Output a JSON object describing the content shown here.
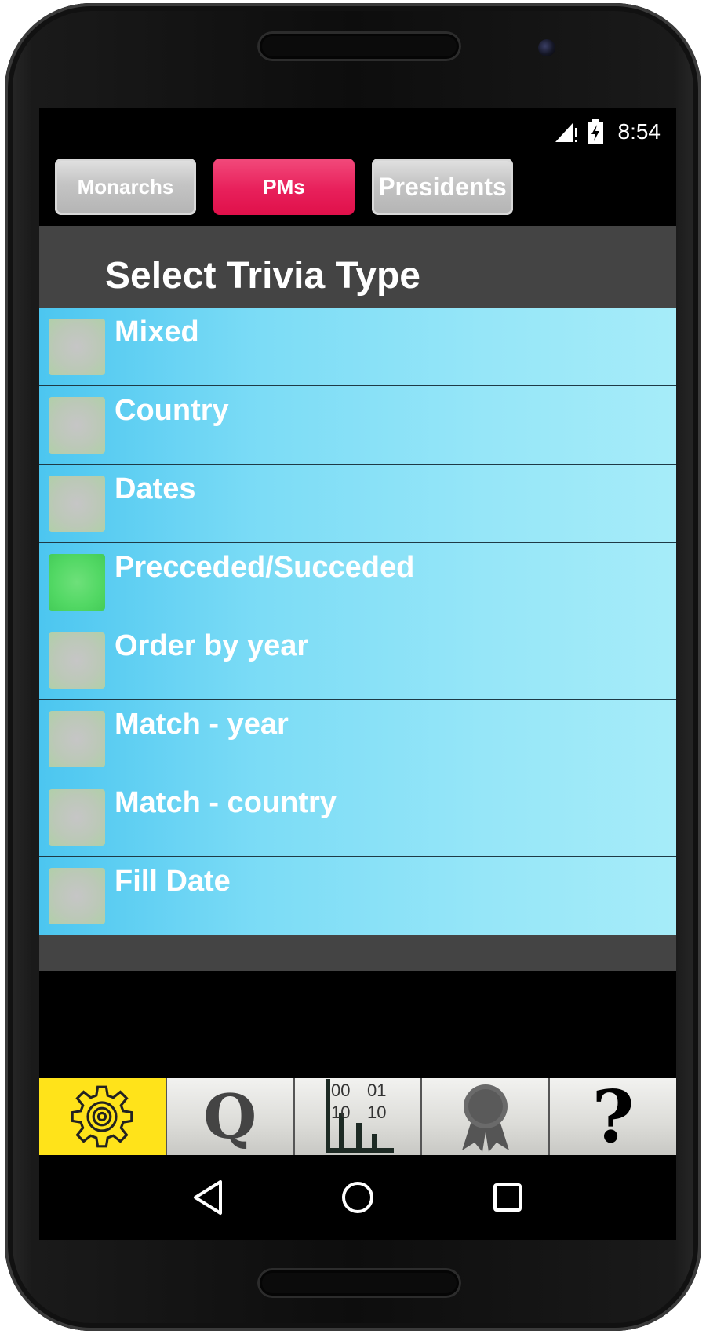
{
  "status_bar": {
    "time": "8:54",
    "icons": [
      "signal-icon",
      "battery-charging-icon"
    ]
  },
  "tabs": [
    {
      "label": "Monarchs",
      "active": false
    },
    {
      "label": "PMs",
      "active": true
    },
    {
      "label": "Presidents",
      "active": false
    }
  ],
  "panel": {
    "title": "Select Trivia Type",
    "items": [
      {
        "label": "Mixed",
        "checked": false
      },
      {
        "label": "Country",
        "checked": false
      },
      {
        "label": "Dates",
        "checked": false
      },
      {
        "label": "Precceded/Succeded",
        "checked": true
      },
      {
        "label": "Order by year",
        "checked": false
      },
      {
        "label": "Match - year",
        "checked": false
      },
      {
        "label": "Match - country",
        "checked": false
      },
      {
        "label": "Fill Date",
        "checked": false
      }
    ]
  },
  "bottom_nav": {
    "items": [
      {
        "icon": "gear-icon",
        "active": true
      },
      {
        "icon": "quiz-q-icon",
        "glyph": "Q",
        "active": false
      },
      {
        "icon": "stats-chart-icon",
        "digits": [
          "00",
          "01",
          "10",
          "10"
        ],
        "active": false
      },
      {
        "icon": "award-ribbon-icon",
        "active": false
      },
      {
        "icon": "help-icon",
        "glyph": "?",
        "active": false
      }
    ]
  },
  "system_nav": {
    "icons": [
      "back-icon",
      "home-icon",
      "recents-icon"
    ]
  },
  "colors": {
    "active_tab": "#e8205b",
    "inactive_tab": "#c4c4c4",
    "list_row": "#7cdcf6",
    "checked_box": "#52d864",
    "active_nav": "#ffe31a",
    "panel_bg": "#444444"
  }
}
